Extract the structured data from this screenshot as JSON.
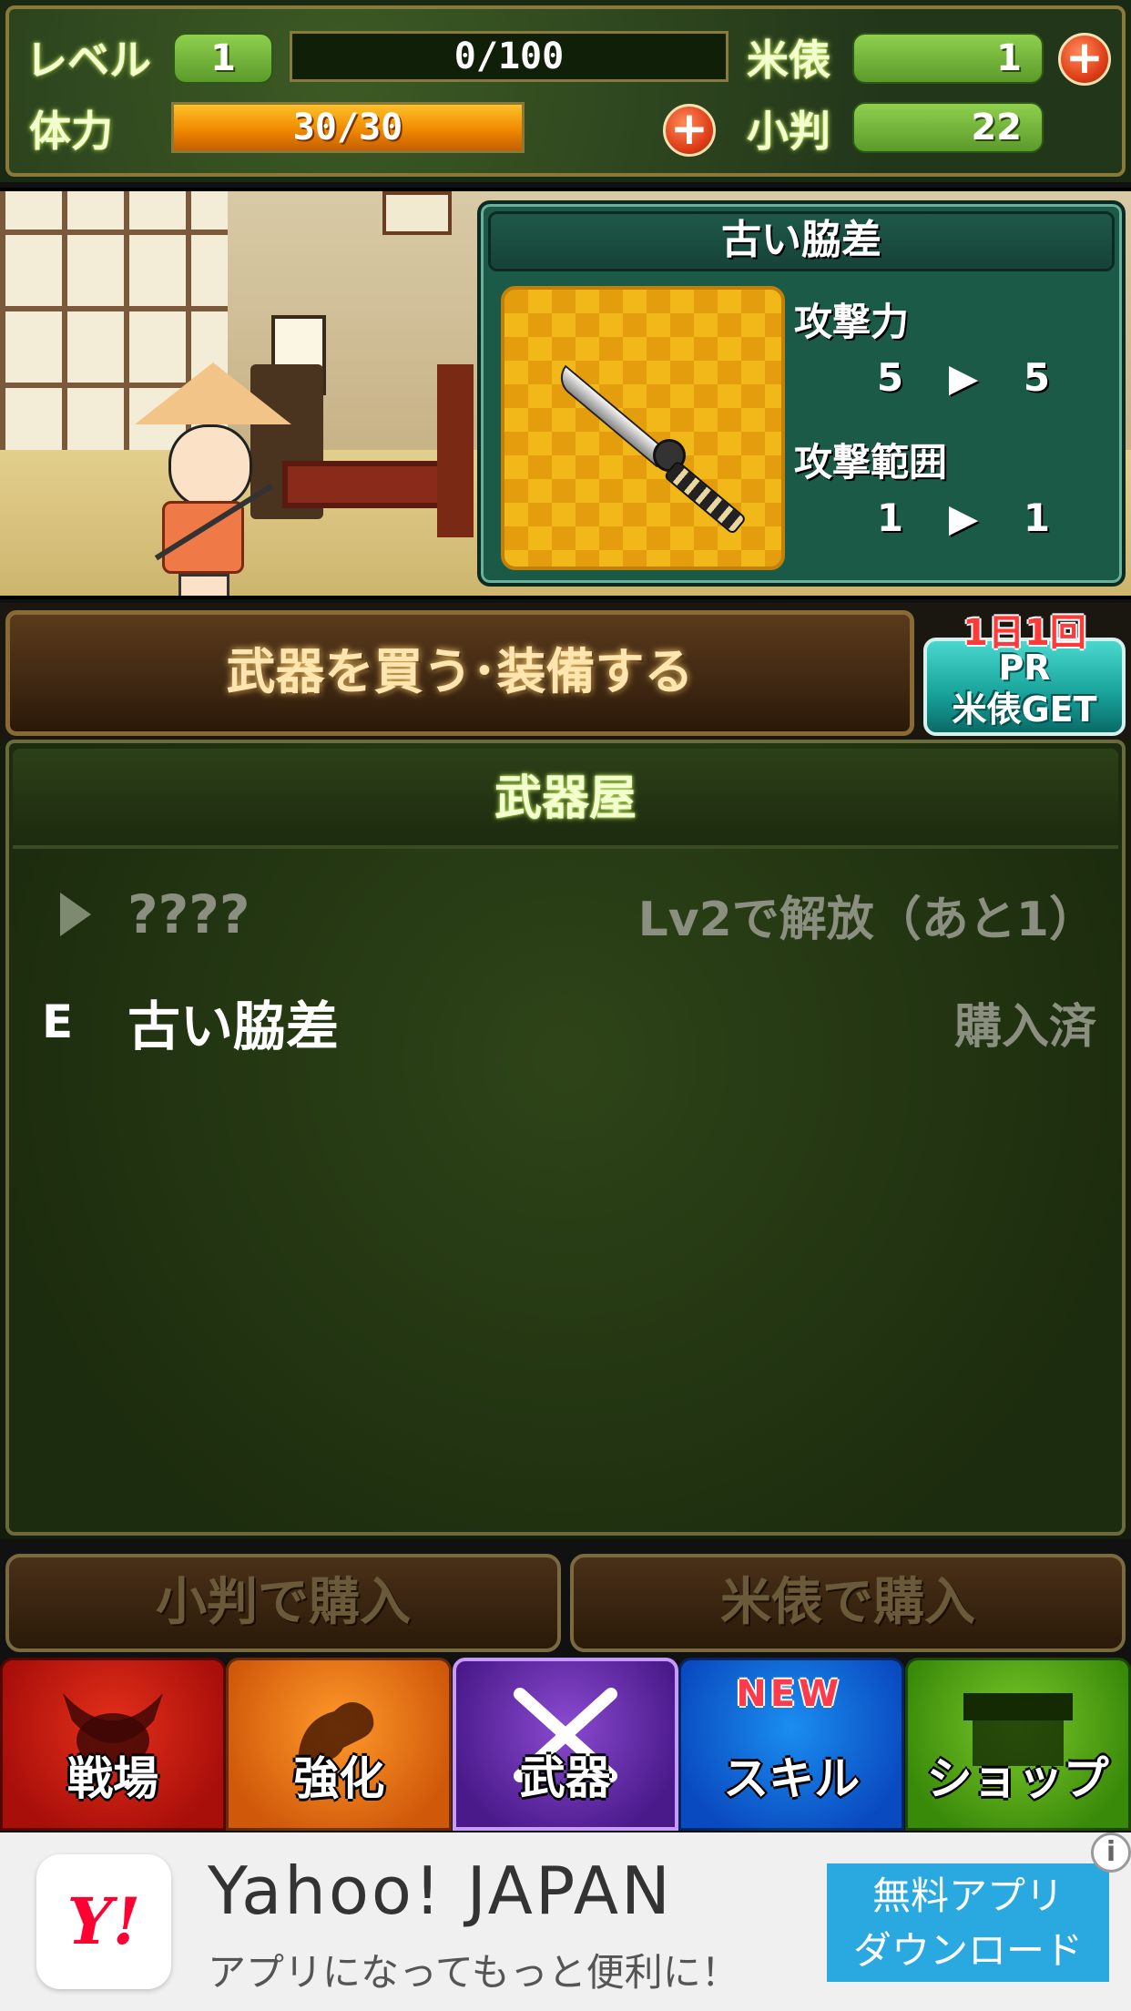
{
  "status": {
    "level_label": "レベル",
    "level_value": "1",
    "exp": "0/100",
    "stamina_label": "体力",
    "stamina": "30/30",
    "stamina_fill": 1.0,
    "rice_label": "米俵",
    "rice_value": "1",
    "koban_label": "小判",
    "koban_value": "22",
    "plus_icon": "+"
  },
  "item_card": {
    "name": "古い脇差",
    "attack_label": "攻撃力",
    "attack_from": "5",
    "attack_to": "5",
    "range_label": "攻撃範囲",
    "range_from": "1",
    "range_to": "1",
    "arrow": "▶"
  },
  "actions": {
    "buy_equip": "武器を買う･装備する",
    "pr_badge": "1日1回",
    "pr_line1": "PR",
    "pr_line2": "米俵GET"
  },
  "shop": {
    "title": "武器屋",
    "items": [
      {
        "mark": "",
        "name": "????",
        "status": "Lv2で解放（あと1）",
        "state": "locked"
      },
      {
        "mark": "E",
        "name": "古い脇差",
        "status": "購入済",
        "state": "owned"
      }
    ]
  },
  "purchase": {
    "koban_buy": "小判で購入",
    "rice_buy": "米俵で購入"
  },
  "nav": {
    "battle": "戦場",
    "power": "強化",
    "weapon": "武器",
    "skill": "スキル",
    "skill_badge": "NEW",
    "shop": "ショップ"
  },
  "ad": {
    "logo": "Y!",
    "title": "Yahoo! JAPAN",
    "subtitle": "アプリになってもっと便利に！",
    "cta_line1": "無料アプリ",
    "cta_line2": "ダウンロード",
    "info_icon": "i"
  }
}
